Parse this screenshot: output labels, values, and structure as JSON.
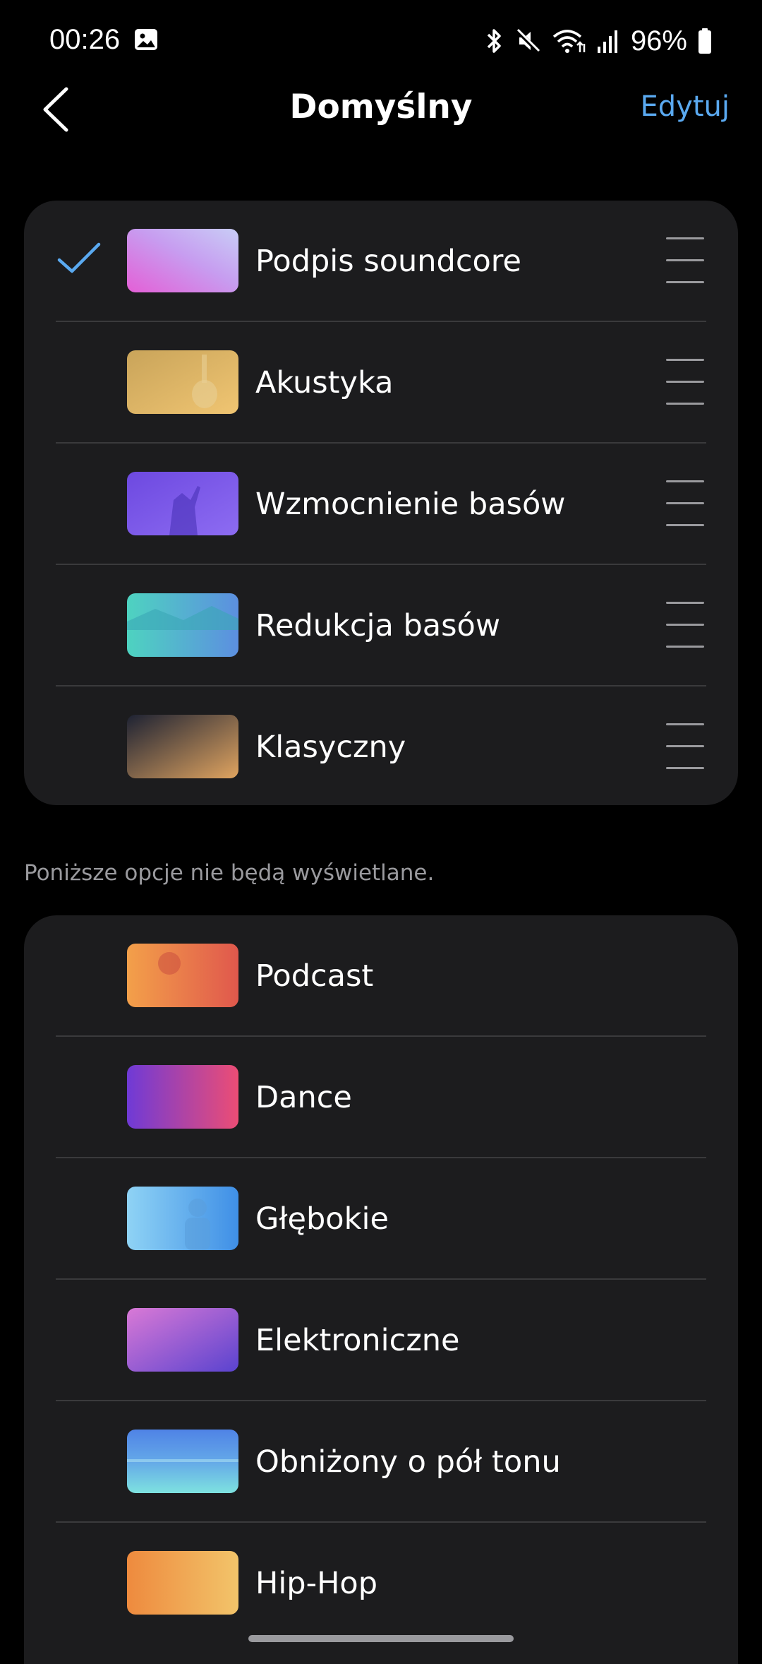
{
  "status_bar": {
    "time": "00:26",
    "battery": "96%",
    "icons": [
      "image-icon",
      "bluetooth-icon",
      "mute-icon",
      "wifi-icon",
      "signal-icon",
      "battery-icon"
    ]
  },
  "header": {
    "back_icon": "chevron-left-icon",
    "title": "Domyślny",
    "edit_label": "Edytuj"
  },
  "colors": {
    "accent": "#5aa9f0",
    "card_bg": "#1c1c1e",
    "background": "#000000"
  },
  "active_presets": [
    {
      "label": "Podpis soundcore",
      "selected": true
    },
    {
      "label": "Akustyka",
      "selected": false
    },
    {
      "label": "Wzmocnienie basów",
      "selected": false
    },
    {
      "label": "Redukcja basów",
      "selected": false
    },
    {
      "label": "Klasyczny",
      "selected": false
    }
  ],
  "hidden_note": "Poniższe opcje nie będą wyświetlane.",
  "hidden_presets": [
    {
      "label": "Podcast"
    },
    {
      "label": "Dance"
    },
    {
      "label": "Głębokie"
    },
    {
      "label": "Elektroniczne"
    },
    {
      "label": "Obniżony o pół tonu"
    },
    {
      "label": "Hip-Hop"
    }
  ]
}
